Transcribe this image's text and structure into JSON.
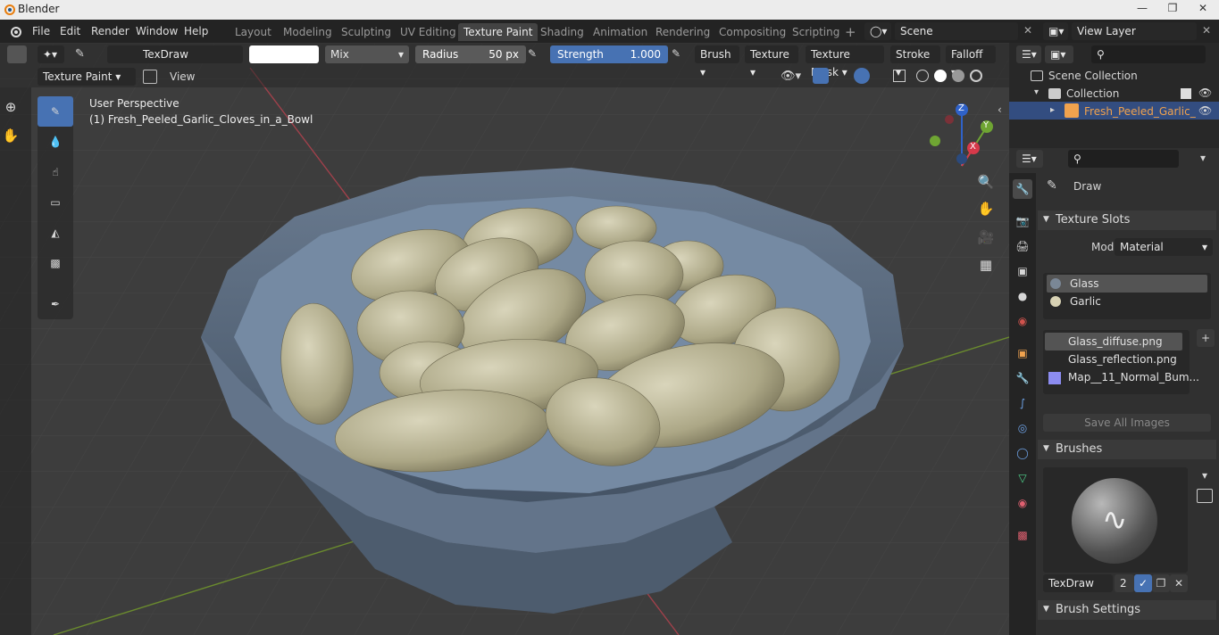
{
  "app": {
    "title": "Blender",
    "menus": [
      "File",
      "Edit",
      "Render",
      "Window",
      "Help"
    ]
  },
  "workspaces": [
    "Layout",
    "Modeling",
    "Sculpting",
    "UV Editing",
    "Texture Paint",
    "Shading",
    "Animation",
    "Rendering",
    "Compositing",
    "Scripting"
  ],
  "scene": {
    "name": "Scene",
    "view_layer": "View Layer"
  },
  "toolbar": {
    "brush_name": "TexDraw",
    "blend_mode": "Mix",
    "radius_label": "Radius",
    "radius_value": "50 px",
    "strength_label": "Strength",
    "strength_value": "1.000",
    "brush": "Brush",
    "texture": "Texture",
    "texture_mask": "Texture Mask",
    "stroke": "Stroke",
    "falloff": "Falloff",
    "mode": "Texture Paint",
    "view": "View"
  },
  "viewport": {
    "perspective": "User Perspective",
    "object_label": "(1) Fresh_Peeled_Garlic_Cloves_in_a_Bowl",
    "axis_x": "X",
    "axis_y": "Y",
    "axis_z": "Z"
  },
  "outliner": {
    "scene_collection": "Scene Collection",
    "collection": "Collection",
    "object": "Fresh_Peeled_Garlic_"
  },
  "properties": {
    "tool": "Draw",
    "texture_slots": "Texture Slots",
    "mode_label": "Mode",
    "mode_value": "Material",
    "materials": [
      "Glass",
      "Garlic"
    ],
    "images": [
      "Glass_diffuse.png",
      "Glass_reflection.png",
      "Map__11_Normal_Bum..."
    ],
    "save_all": "Save All Images",
    "brushes": "Brushes",
    "brush_name": "TexDraw",
    "brush_users": "2",
    "brush_settings": "Brush Settings"
  },
  "colors": {
    "accent": "#4772b3",
    "active_object": "#f0a24e",
    "bowl": "#5b6b80",
    "garlic": "#b8b394"
  }
}
